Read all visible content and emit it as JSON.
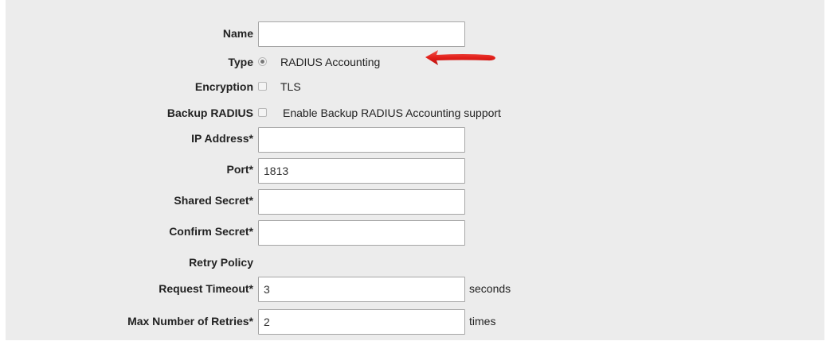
{
  "form": {
    "name": {
      "label": "Name",
      "value": ""
    },
    "type": {
      "label": "Type",
      "option_label": "RADIUS Accounting",
      "selected": true
    },
    "encryption": {
      "label": "Encryption",
      "option_label": "TLS",
      "checked": false
    },
    "backup_radius": {
      "label": "Backup RADIUS",
      "option_label": "Enable Backup RADIUS Accounting support",
      "checked": false
    },
    "ip_address": {
      "label": "IP Address*",
      "value": ""
    },
    "port": {
      "label": "Port*",
      "value": "1813"
    },
    "shared_secret": {
      "label": "Shared Secret*",
      "value": ""
    },
    "confirm_secret": {
      "label": "Confirm Secret*",
      "value": ""
    },
    "retry_policy": {
      "label": "Retry Policy"
    },
    "request_timeout": {
      "label": "Request Timeout*",
      "value": "3",
      "unit": "seconds"
    },
    "max_retries": {
      "label": "Max Number of Retries*",
      "value": "2",
      "unit": "times"
    }
  },
  "annotation": {
    "arrow_color": "#e8211f",
    "arrow_direction": "left"
  },
  "colors": {
    "panel_bg": "#ececec",
    "field_border": "#a6a6a6"
  }
}
